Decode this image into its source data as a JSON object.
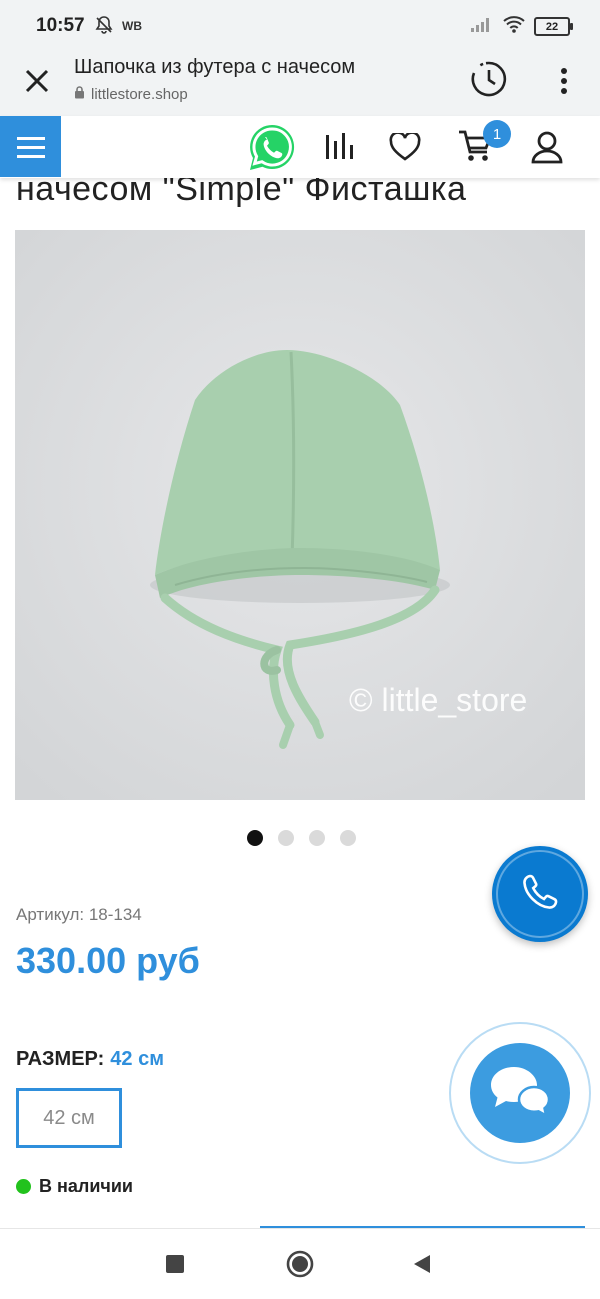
{
  "status_bar": {
    "time": "10:57",
    "carrier_label": "WB",
    "battery": "22"
  },
  "browser": {
    "title": "Шапочка из футера с начесом",
    "url": "littlestore.shop"
  },
  "header": {
    "cart_count": "1"
  },
  "product": {
    "title_visible": "начесом \"Simple\" Фисташка",
    "watermark": "© little_store",
    "carousel": {
      "total": 4,
      "active": 1
    },
    "sku": "Артикул: 18-134",
    "price": "330.00 руб",
    "size_label": "РАЗМЕР:",
    "size_selected": "42 см",
    "size_options": [
      "42 см"
    ],
    "stock_status": "В наличии"
  },
  "colors": {
    "accent": "#2f8fdc",
    "in_stock": "#22c21d",
    "whatsapp": "#25d366",
    "hat": "#a8cfae"
  },
  "icons": [
    "close-icon",
    "lock-icon",
    "history-icon",
    "more-vert-icon",
    "menu-icon",
    "whatsapp-icon",
    "compare-icon",
    "heart-icon",
    "cart-icon",
    "user-icon",
    "phone-icon",
    "chat-icon"
  ]
}
